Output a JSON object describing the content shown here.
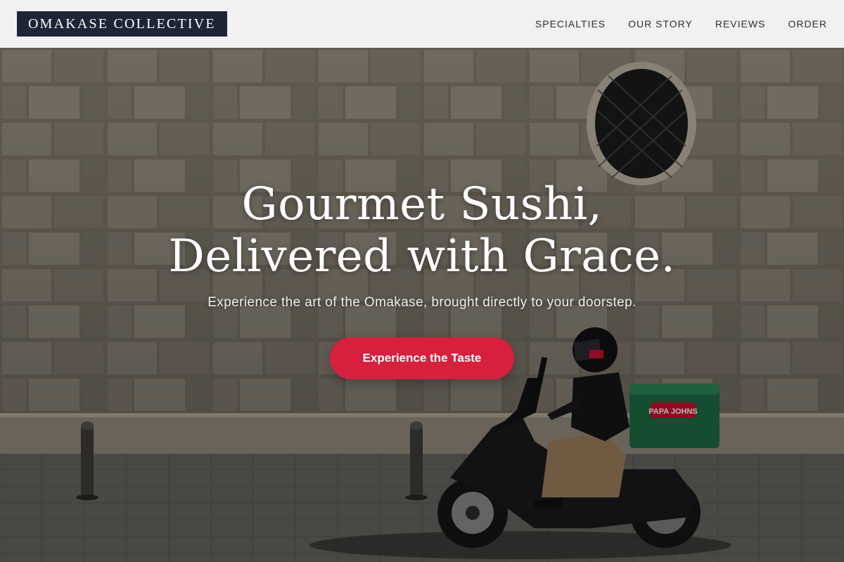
{
  "brand": {
    "name": "OMAKASE COLLECTIVE"
  },
  "nav": {
    "items": [
      {
        "label": "SPECIALTIES"
      },
      {
        "label": "OUR STORY"
      },
      {
        "label": "REVIEWS"
      },
      {
        "label": "ORDER"
      }
    ]
  },
  "hero": {
    "title_line1": "Gourmet Sushi,",
    "title_line2": "Delivered with Grace.",
    "subtitle": "Experience the art of the Omakase, brought directly to your doorstep.",
    "cta_label": "Experience the Taste",
    "box_brand": "PAPA JOHNS"
  },
  "colors": {
    "header_bg": "#f1f1f1",
    "logo_bg": "#1d2537",
    "cta_bg": "#d71f3e",
    "box_green": "#1e6b45"
  }
}
